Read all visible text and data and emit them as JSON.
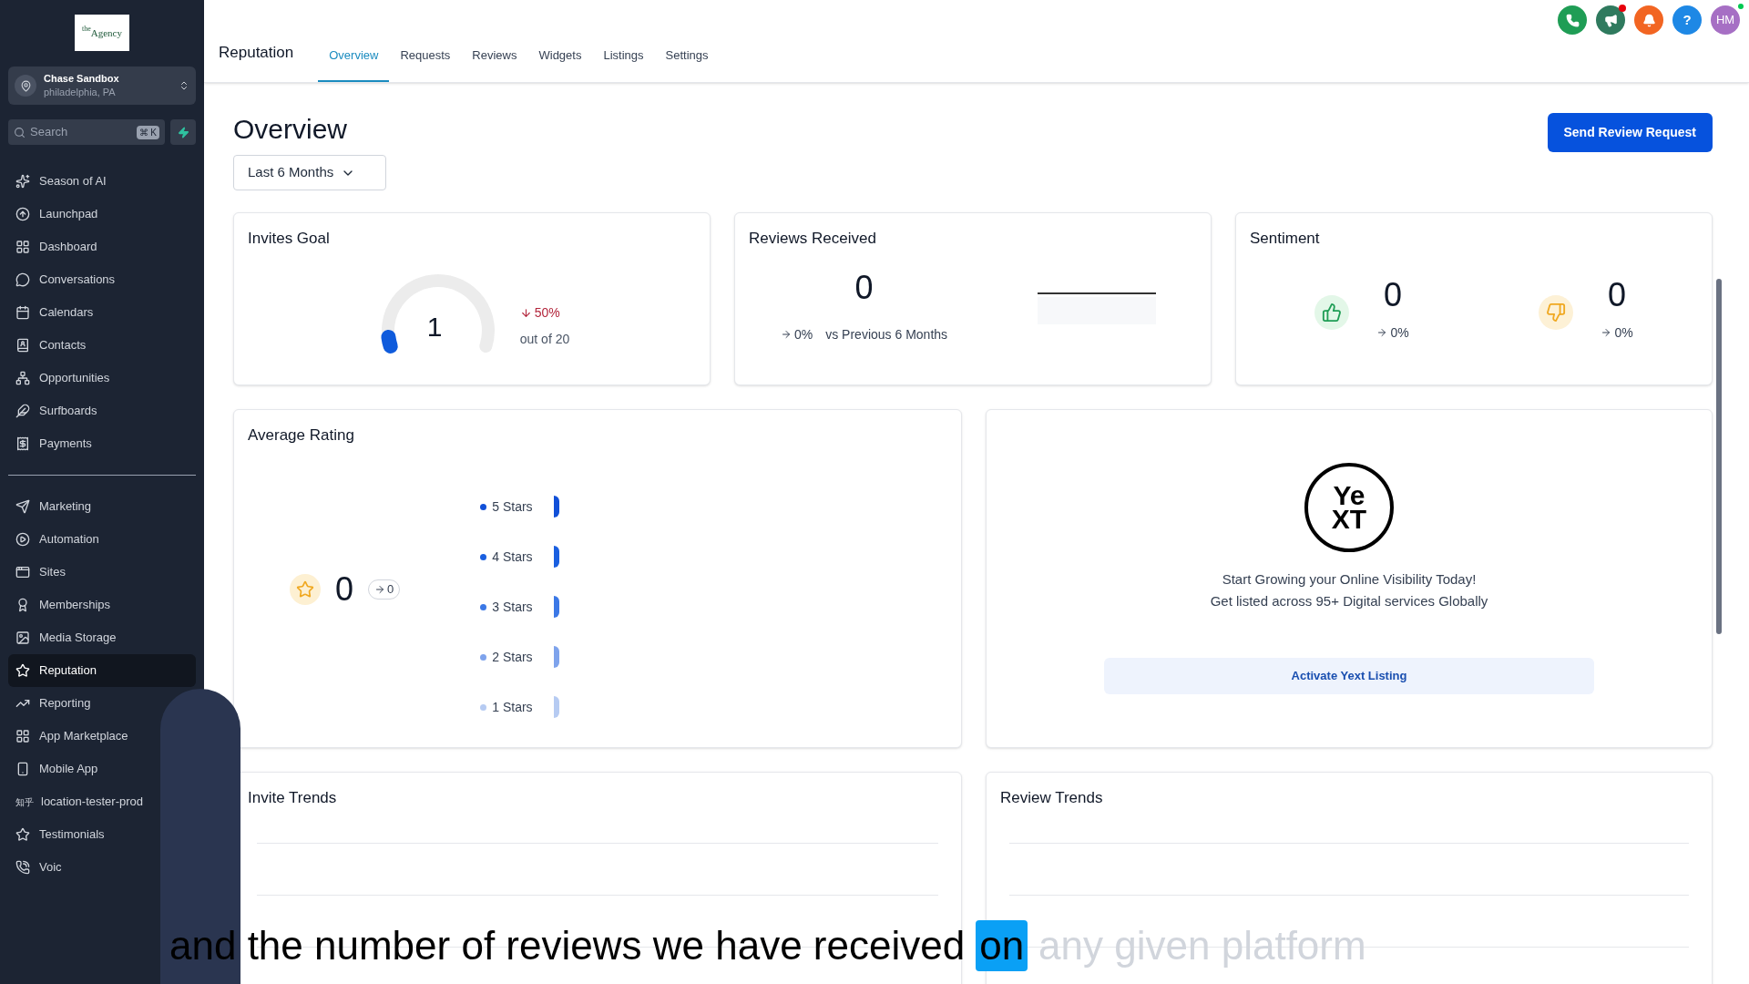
{
  "sidebar": {
    "logo": {
      "small": "the",
      "name": "Agency"
    },
    "account": {
      "name": "Chase Sandbox",
      "location": "philadelphia, PA"
    },
    "search": {
      "placeholder": "Search",
      "shortcut": "⌘ K"
    },
    "groups": [
      [
        {
          "label": "Season of AI",
          "selected": false
        },
        {
          "label": "Launchpad",
          "selected": false
        },
        {
          "label": "Dashboard",
          "selected": false
        },
        {
          "label": "Conversations",
          "selected": false
        },
        {
          "label": "Calendars",
          "selected": false
        },
        {
          "label": "Contacts",
          "selected": false
        },
        {
          "label": "Opportunities",
          "selected": false
        },
        {
          "label": "Surfboards",
          "selected": false
        },
        {
          "label": "Payments",
          "selected": false
        }
      ],
      [
        {
          "label": "Marketing",
          "selected": false
        },
        {
          "label": "Automation",
          "selected": false
        },
        {
          "label": "Sites",
          "selected": false
        },
        {
          "label": "Memberships",
          "selected": false
        },
        {
          "label": "Media Storage",
          "selected": false
        },
        {
          "label": "Reputation",
          "selected": true
        },
        {
          "label": "Reporting",
          "selected": false
        },
        {
          "label": "App Marketplace",
          "selected": false
        },
        {
          "label": "Mobile App",
          "selected": false
        },
        {
          "label": "location-tester-prod",
          "icon_text": "知乎",
          "selected": false
        },
        {
          "label": "Testimonials",
          "selected": false
        },
        {
          "label": "Voic",
          "selected": false
        }
      ]
    ]
  },
  "header": {
    "title": "Reputation",
    "tabs": [
      {
        "label": "Overview",
        "selected": true
      },
      {
        "label": "Requests",
        "selected": false
      },
      {
        "label": "Reviews",
        "selected": false
      },
      {
        "label": "Widgets",
        "selected": false
      },
      {
        "label": "Listings",
        "selected": false
      },
      {
        "label": "Settings",
        "selected": false
      }
    ],
    "actions": [
      {
        "kind": "phone",
        "badge": false
      },
      {
        "kind": "megaphone",
        "badge": true
      },
      {
        "kind": "bell",
        "badge": false
      },
      {
        "kind": "help",
        "text": "?",
        "badge": false
      }
    ],
    "avatar": {
      "initials": "HM",
      "online": true
    }
  },
  "page": {
    "title": "Overview",
    "primary_button": "Send Review Request",
    "period": "Last 6 Months"
  },
  "invites_goal": {
    "title": "Invites Goal",
    "value": "1",
    "level": 0.05,
    "change": "50%",
    "goal": "out of 20"
  },
  "reviews_received": {
    "title": "Reviews Received",
    "value": "0",
    "change": "0%",
    "comparison": "vs Previous 6 Months"
  },
  "sentiment": {
    "title": "Sentiment",
    "positive": {
      "value": "0",
      "change": "0%"
    },
    "negative": {
      "value": "0",
      "change": "0%"
    }
  },
  "average_rating": {
    "title": "Average Rating",
    "value": "0",
    "change": "0",
    "breakdown": [
      {
        "label": "5 Stars",
        "color": "#1150d8"
      },
      {
        "label": "4 Stars",
        "color": "#1a5fe0"
      },
      {
        "label": "3 Stars",
        "color": "#3b78e6"
      },
      {
        "label": "2 Stars",
        "color": "#7ea3ec"
      },
      {
        "label": "1 Stars",
        "color": "#b6cbf2"
      }
    ]
  },
  "yext": {
    "logo": [
      "Ye",
      "XT"
    ],
    "lines": [
      "Start Growing your Online Visibility Today!",
      "Get listed across 95+ Digital services Globally"
    ],
    "button": "Activate Yext Listing"
  },
  "invite_trends": {
    "title": "Invite Trends"
  },
  "review_trends": {
    "title": "Review Trends"
  },
  "caption": {
    "spoken": "and the number of reviews we have received",
    "current": "on",
    "upcoming": "any given platform"
  }
}
